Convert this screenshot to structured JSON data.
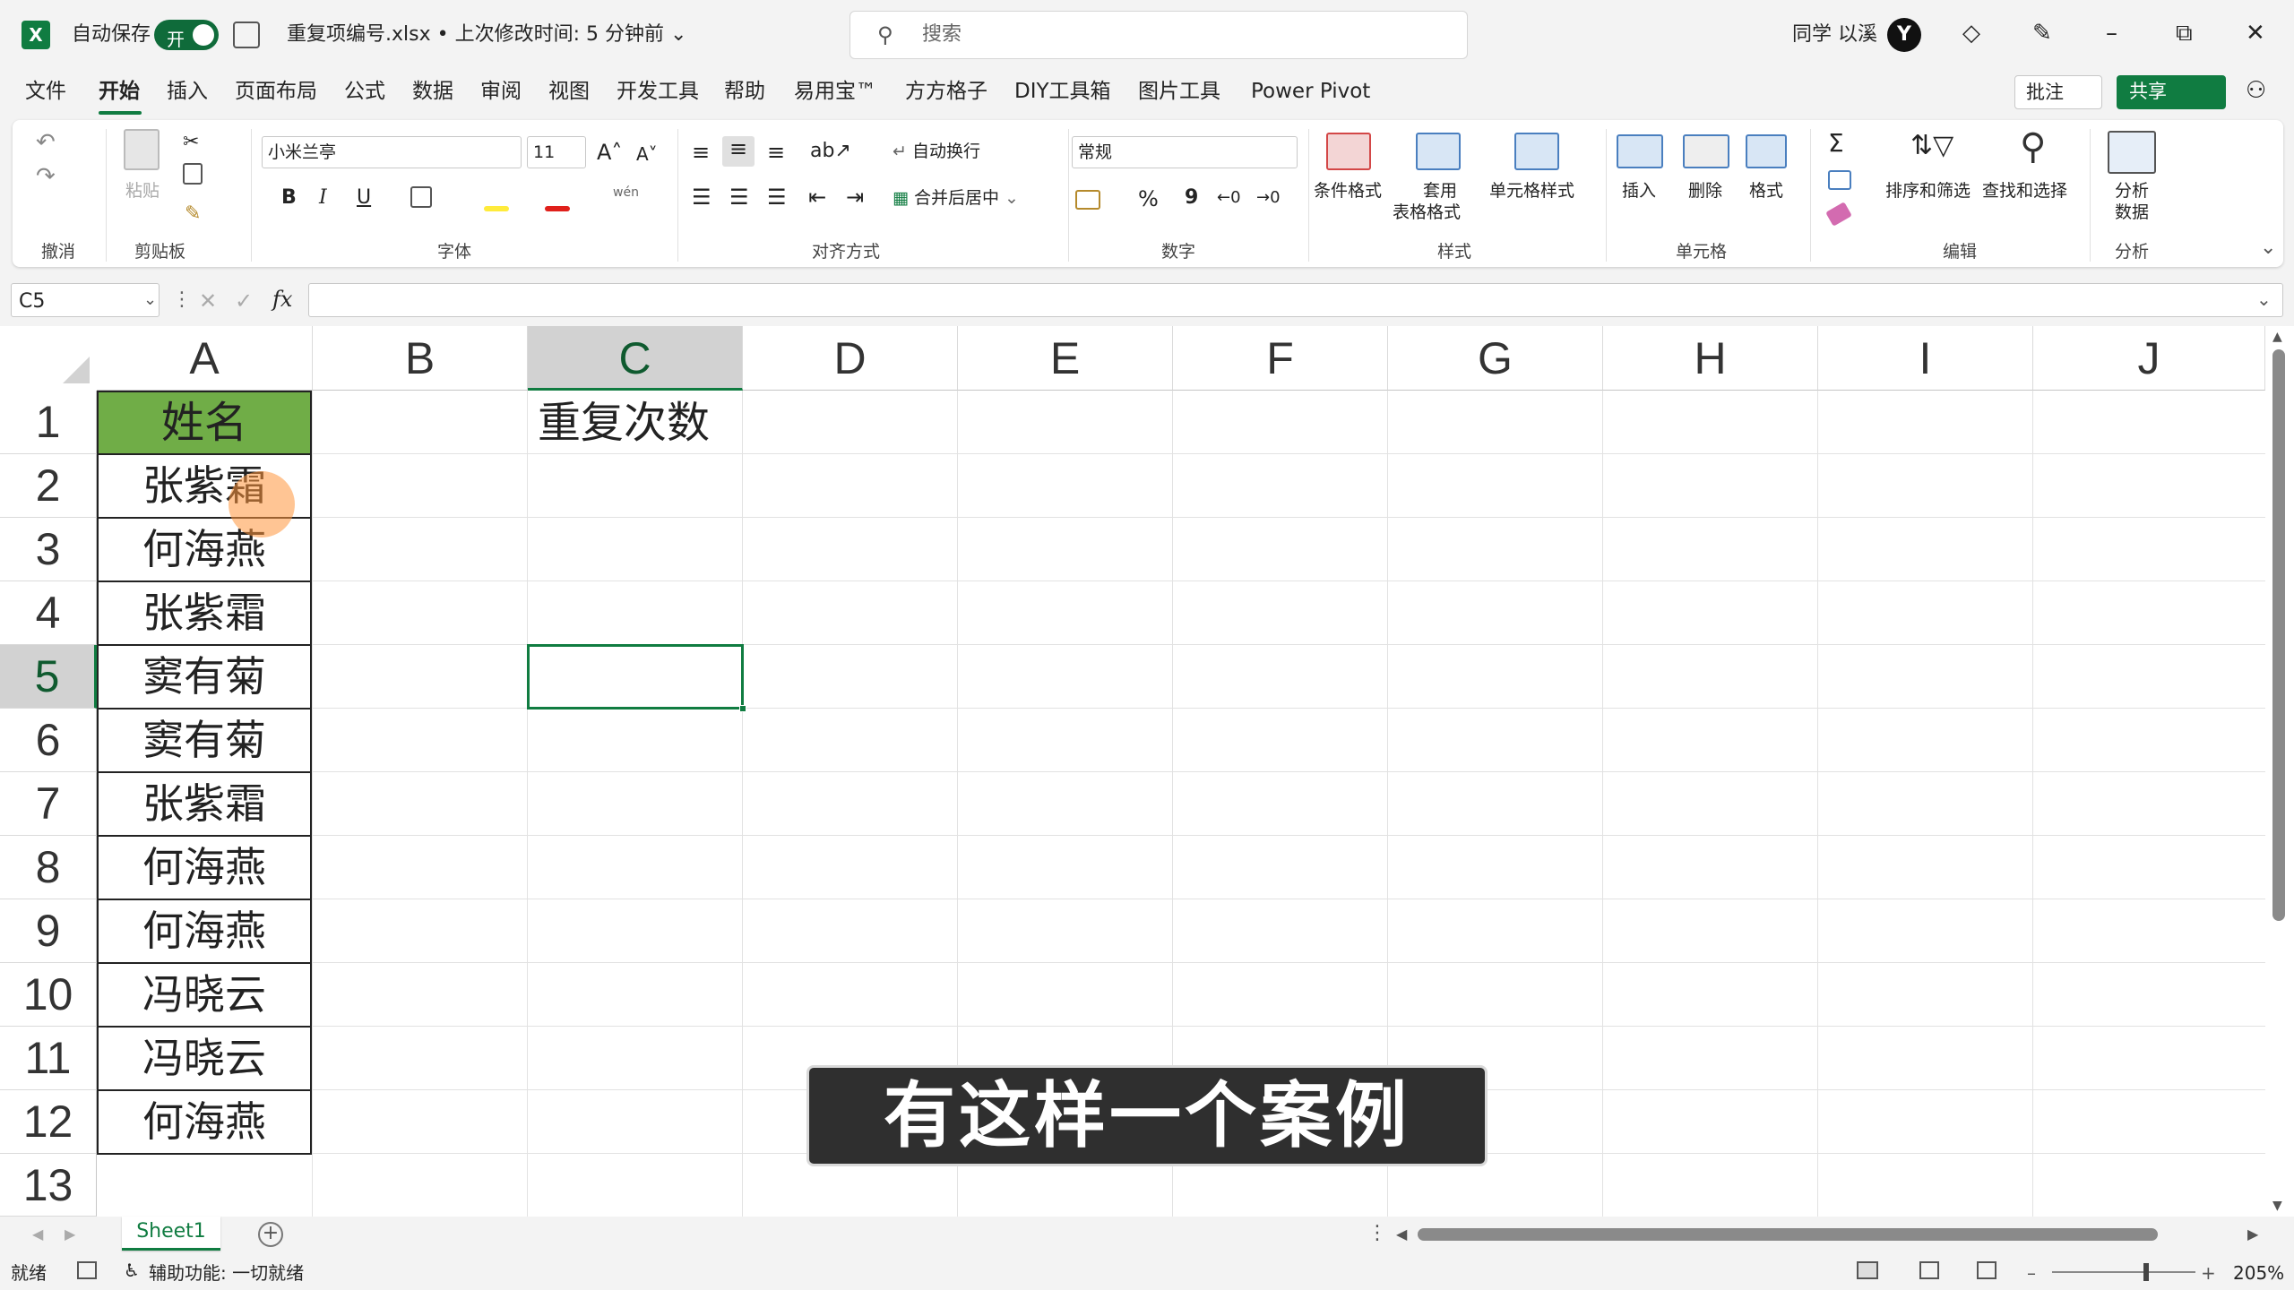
{
  "titlebar": {
    "app_icon": "excel-logo",
    "app_letter": "X",
    "autosave_label": "自动保存",
    "autosave_state": "开",
    "doc_title": "重复项编号.xlsx • 上次修改时间: 5 分钟前 ⌄",
    "search_placeholder": "搜索",
    "user_name": "同学 以溪",
    "avatar_letter": "Y",
    "minimize": "–",
    "restore": "⧉",
    "close": "✕"
  },
  "menu": {
    "items": [
      "文件",
      "开始",
      "插入",
      "页面布局",
      "公式",
      "数据",
      "审阅",
      "视图",
      "开发工具",
      "帮助",
      "易用宝™",
      "方方格子",
      "DIY工具箱",
      "图片工具",
      "Power Pivot"
    ],
    "active": "开始",
    "comment_button": "批注",
    "share_button": "共享"
  },
  "ribbon": {
    "undo_group": "撤消",
    "clipboard_group": "剪贴板",
    "paste_label": "粘贴",
    "font_group": "字体",
    "font_name": "小米兰亭",
    "font_size": "11",
    "bold": "B",
    "italic": "I",
    "underline": "U",
    "wen_label": "wén",
    "align_group": "对齐方式",
    "wrap_text": "自动换行",
    "merge_center": "合并后居中",
    "number_group": "数字",
    "number_format": "常规",
    "percent": "%",
    "comma": "9",
    "styles_group": "样式",
    "cond_format": "条件格式",
    "table_format_1": "套用",
    "table_format_2": "表格格式",
    "cell_styles": "单元格样式",
    "cells_group": "单元格",
    "insert": "插入",
    "delete": "删除",
    "format": "格式",
    "editing_group": "编辑",
    "sort_filter": "排序和筛选",
    "find_select": "查找和选择",
    "analysis_group": "分析",
    "analyze_1": "分析",
    "analyze_2": "数据",
    "sum_symbol": "Σ"
  },
  "formula_bar": {
    "name_box": "C5",
    "fx": "fx",
    "formula": ""
  },
  "sheet": {
    "columns": [
      "A",
      "B",
      "C",
      "D",
      "E",
      "F",
      "G",
      "H",
      "I",
      "J"
    ],
    "selected_column": "C",
    "rows": [
      "1",
      "2",
      "3",
      "4",
      "5",
      "6",
      "7",
      "8",
      "9",
      "10",
      "11",
      "12",
      "13"
    ],
    "selected_row": "5",
    "colA": [
      "姓名",
      "张紫霜",
      "何海燕",
      "张紫霜",
      "窦有菊",
      "窦有菊",
      "张紫霜",
      "何海燕",
      "何海燕",
      "冯晓云",
      "冯晓云",
      "何海燕"
    ],
    "c1": "重复次数",
    "header_fill": "#70ad47",
    "accent": "#107c41"
  },
  "caption": "有这样一个案例",
  "tabs": {
    "sheet1": "Sheet1",
    "add": "+"
  },
  "status": {
    "ready": "就绪",
    "accessibility": "辅助功能: 一切就绪",
    "zoom": "205%",
    "zoom_minus": "–",
    "zoom_plus": "+"
  }
}
